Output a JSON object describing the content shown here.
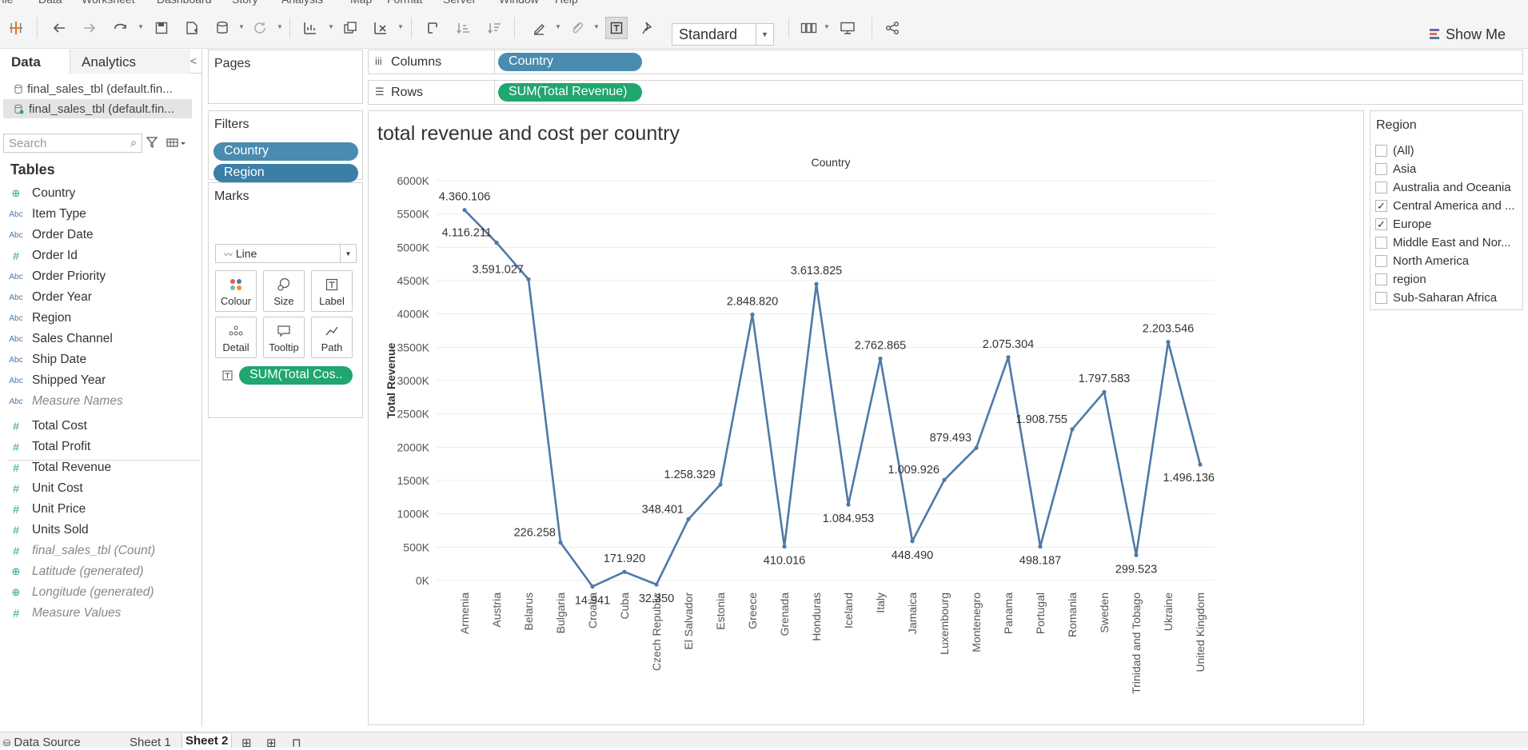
{
  "menu": [
    "File",
    "Data",
    "Worksheet",
    "Dashboard",
    "Story",
    "Analysis",
    "Map",
    "Format",
    "Server",
    "Window",
    "Help"
  ],
  "toolbar": {
    "fit_label": "Standard",
    "show_me_label": "Show Me"
  },
  "left_pane": {
    "tab_data": "Data",
    "tab_analytics": "Analytics",
    "data_sources": [
      "final_sales_tbl (default.fin...",
      "final_sales_tbl (default.fin..."
    ],
    "search_placeholder": "Search",
    "tables_heading": "Tables",
    "dimensions": [
      {
        "type": "geo",
        "name": "Country"
      },
      {
        "type": "abc",
        "name": "Item Type"
      },
      {
        "type": "abc",
        "name": "Order Date"
      },
      {
        "type": "num",
        "name": "Order Id"
      },
      {
        "type": "abc",
        "name": "Order Priority"
      },
      {
        "type": "abc",
        "name": "Order Year"
      },
      {
        "type": "abc",
        "name": "Region"
      },
      {
        "type": "abc",
        "name": "Sales Channel"
      },
      {
        "type": "abc",
        "name": "Ship Date"
      },
      {
        "type": "abc",
        "name": "Shipped Year"
      },
      {
        "type": "abc",
        "name": "Measure Names",
        "italic": true
      }
    ],
    "measures": [
      {
        "type": "num",
        "name": "Total Cost"
      },
      {
        "type": "num",
        "name": "Total Profit"
      },
      {
        "type": "num",
        "name": "Total Revenue"
      },
      {
        "type": "num",
        "name": "Unit Cost"
      },
      {
        "type": "num",
        "name": "Unit Price"
      },
      {
        "type": "num",
        "name": "Units Sold"
      },
      {
        "type": "num",
        "name": "final_sales_tbl (Count)",
        "italic": true
      },
      {
        "type": "geo",
        "name": "Latitude (generated)",
        "italic": true
      },
      {
        "type": "geo",
        "name": "Longitude (generated)",
        "italic": true
      },
      {
        "type": "num",
        "name": "Measure Values",
        "italic": true
      }
    ]
  },
  "shelves": {
    "pages_title": "Pages",
    "filters_title": "Filters",
    "filter_pills": [
      "Country",
      "Region"
    ],
    "marks_title": "Marks",
    "mark_type": "Line",
    "mark_cards": [
      "Colour",
      "Size",
      "Label",
      "Detail",
      "Tooltip",
      "Path"
    ],
    "label_pill": "SUM(Total Cos..",
    "columns_label": "Columns",
    "columns_pill": "Country",
    "rows_label": "Rows",
    "rows_pill": "SUM(Total Revenue)"
  },
  "filter_card": {
    "title": "Region",
    "items": [
      {
        "label": "(All)",
        "checked": false
      },
      {
        "label": "Asia",
        "checked": false
      },
      {
        "label": "Australia and Oceania",
        "checked": false
      },
      {
        "label": "Central America and ...",
        "checked": true
      },
      {
        "label": "Europe",
        "checked": true
      },
      {
        "label": "Middle East and Nor...",
        "checked": false
      },
      {
        "label": "North America",
        "checked": false
      },
      {
        "label": "region",
        "checked": false
      },
      {
        "label": "Sub-Saharan Africa",
        "checked": false
      }
    ]
  },
  "bottom_tabs": [
    "Data Source",
    "Sheet 1",
    "Sheet 2"
  ],
  "chart_data": {
    "type": "line",
    "title": "total revenue and cost per country",
    "xlabel": "Country",
    "ylabel": "Total Revenue",
    "ylim": [
      0,
      6000
    ],
    "y_ticks": [
      "0K",
      "500K",
      "1000K",
      "1500K",
      "2000K",
      "2500K",
      "3000K",
      "3500K",
      "4000K",
      "4500K",
      "5000K",
      "5500K",
      "6000K"
    ],
    "grid": true,
    "line_color": "#4e79a7",
    "categories": [
      "Armenia",
      "Austria",
      "Belarus",
      "Bulgaria",
      "Croatia",
      "Cuba",
      "Czech Republic",
      "El Salvador",
      "Estonia",
      "Greece",
      "Grenada",
      "Honduras",
      "Iceland",
      "Italy",
      "Jamaica",
      "Luxembourg",
      "Montenegro",
      "Panama",
      "Portugal",
      "Romania",
      "Sweden",
      "Trinidad and Tobago",
      "Ukraine",
      "United Kingdom"
    ],
    "values": [
      5560,
      5070,
      4520,
      570,
      -90,
      130,
      -60,
      920,
      1440,
      3990,
      510,
      4450,
      1140,
      3330,
      590,
      1510,
      1990,
      3350,
      510,
      2270,
      2830,
      380,
      3580,
      1740
    ],
    "labels": [
      "4.360.106",
      "4.116.211",
      "3.591.027",
      "226.258",
      "14.941",
      "171.920",
      "32.350",
      "348.401",
      "1.258.329",
      "2.848.820",
      "410.016",
      "3.613.825",
      "1.084.953",
      "2.762.865",
      "448.490",
      "1.009.926",
      "879.493",
      "2.075.304",
      "498.187",
      "1.908.755",
      "1.797.583",
      "299.523",
      "2.203.546",
      "1.496.136"
    ]
  }
}
